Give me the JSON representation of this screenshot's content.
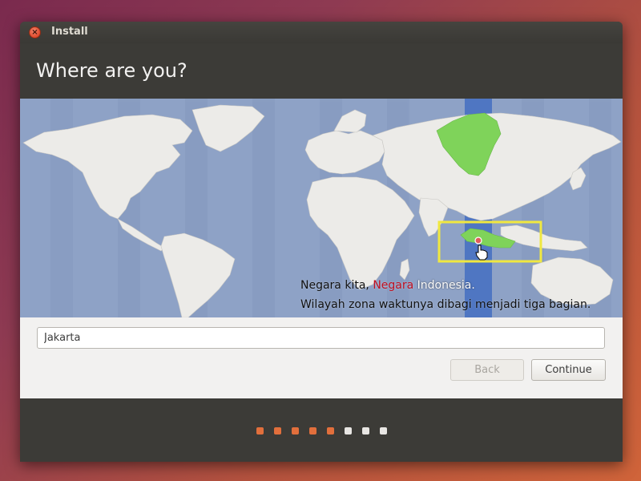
{
  "window": {
    "title": "Install"
  },
  "header": {
    "title": "Where are you?"
  },
  "map": {
    "caption_line1_part1": "Negara kita, ",
    "caption_line1_part2": "Negara",
    "caption_line1_part3": " Indonesia.",
    "caption_line2": "Wilayah zona waktunya dibagi menjadi tiga bagian.",
    "selected_location": "Jakarta",
    "colors": {
      "ocean": "#8ea2c6",
      "land": "#ecebe8",
      "highlight_band": "#4f76c2",
      "highlighted_country": "#7fd35a",
      "annotation_box": "#f0e840",
      "pin": "#e05a5a"
    }
  },
  "form": {
    "location_value": "Jakarta",
    "back_label": "Back",
    "continue_label": "Continue"
  },
  "progress": {
    "total_steps": 8,
    "completed_steps": 5,
    "colors": {
      "done": "#e26f3c",
      "todo": "#e8e6e3"
    }
  }
}
